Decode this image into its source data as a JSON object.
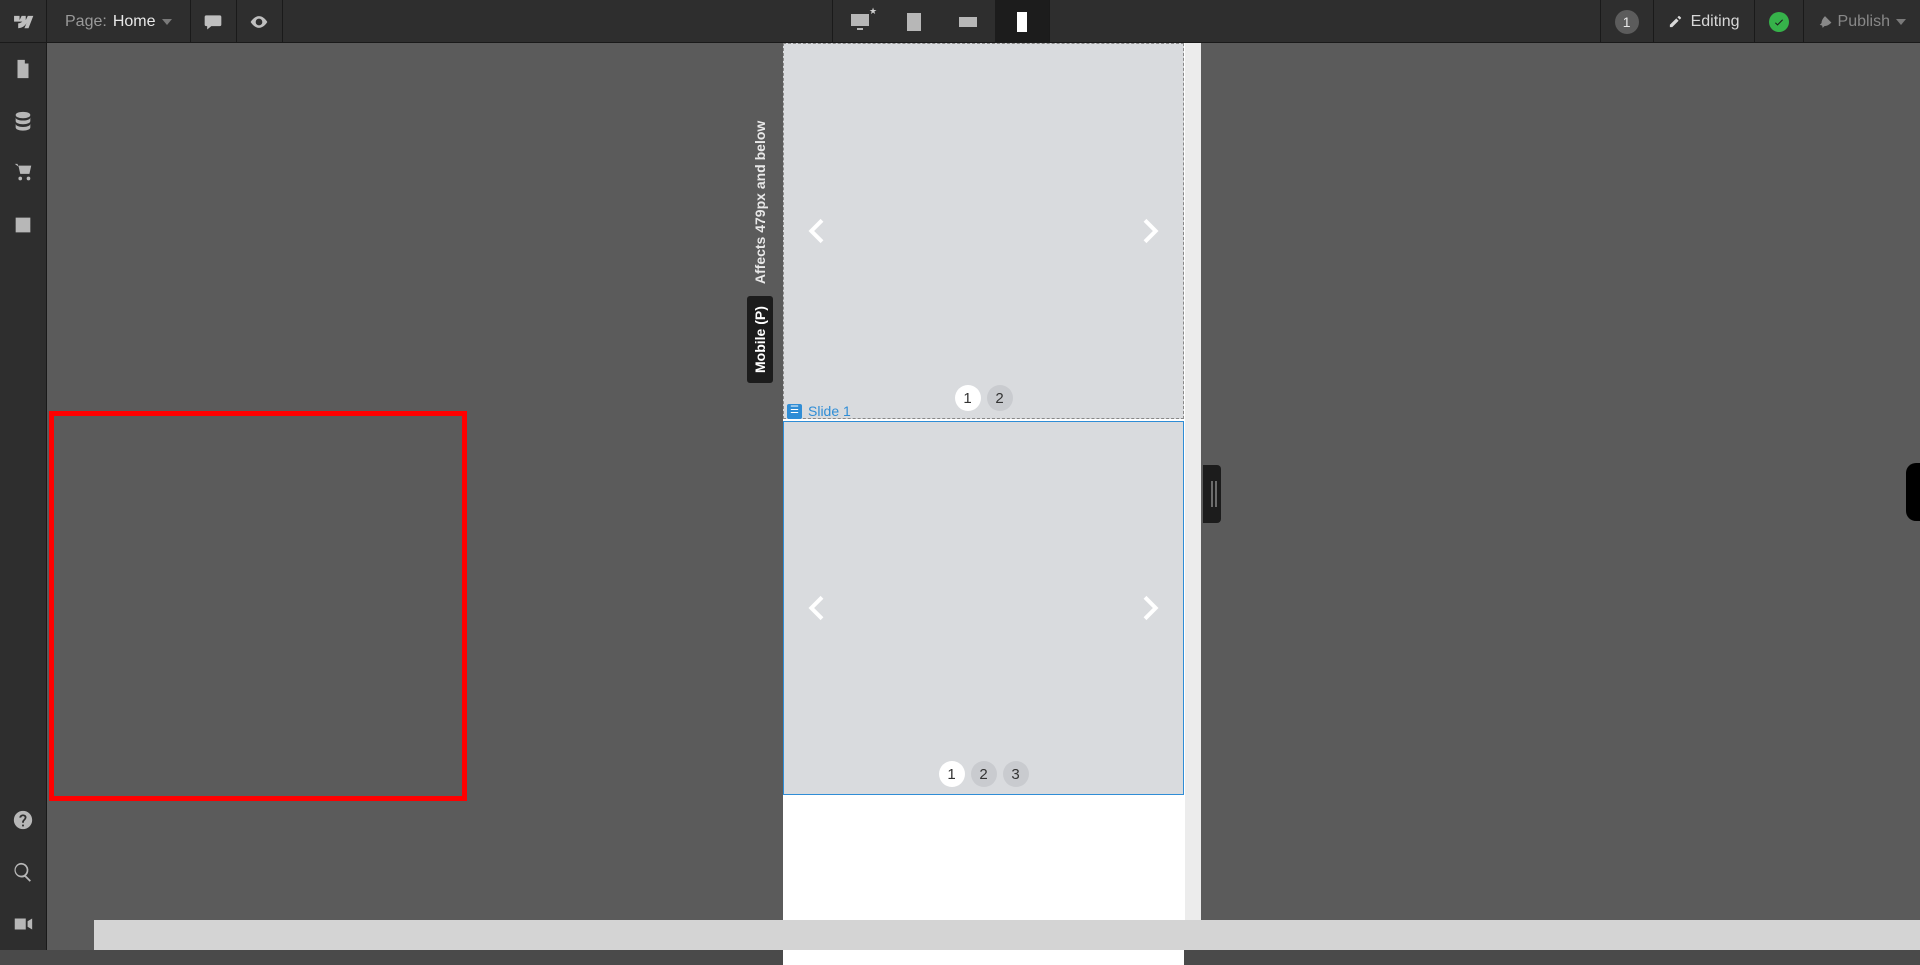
{
  "topbar": {
    "page_label": "Page:",
    "page_name": "Home",
    "collaborator_count": "1",
    "editing_label": "Editing",
    "publish_label": "Publish"
  },
  "breakpoint": {
    "name": "Mobile (P)",
    "description": "Affects 479px and below"
  },
  "canvas": {
    "selected_label": "Slide 1",
    "slider1_dots": [
      "1",
      "2"
    ],
    "slider2_dots": [
      "1",
      "2",
      "3"
    ]
  }
}
